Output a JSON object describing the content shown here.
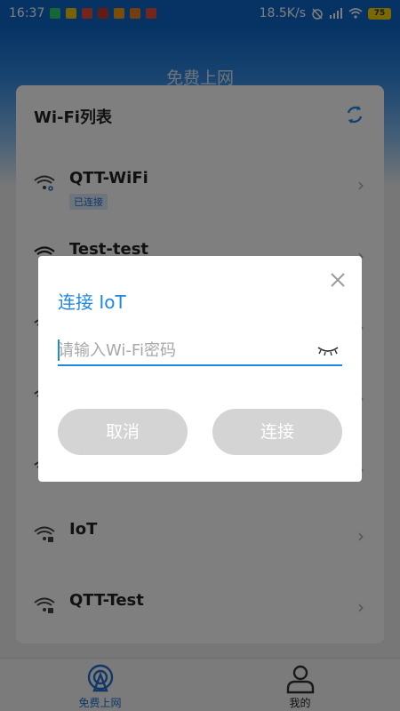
{
  "status_bar": {
    "time": "16:37",
    "net_speed": "18.5K/s",
    "battery": "75",
    "notification_colors": [
      "#2ecc71",
      "#f1c40f",
      "#e74c3c",
      "#c0392b",
      "#f39c12",
      "#e67e22",
      "#e74c3c"
    ]
  },
  "header": {
    "title": "免费上网"
  },
  "wifi_list": {
    "title": "Wi-Fi列表",
    "items": [
      {
        "ssid": "QTT-WiFi",
        "badge": "已连接"
      },
      {
        "ssid": "Test-test",
        "badge": ""
      },
      {
        "ssid": "",
        "badge": ""
      },
      {
        "ssid": "",
        "badge": ""
      },
      {
        "ssid": "",
        "badge": ""
      },
      {
        "ssid": "IoT",
        "badge": ""
      },
      {
        "ssid": "QTT-Test",
        "badge": ""
      }
    ]
  },
  "tabs": [
    {
      "label": "免费上网",
      "active": true
    },
    {
      "label": "我的",
      "active": false
    }
  ],
  "dialog": {
    "title": "连接 IoT",
    "password_placeholder": "请输入Wi-Fi密码",
    "cancel_label": "取消",
    "connect_label": "连接"
  },
  "colors": {
    "accent": "#1e88e5",
    "header_blue": "#0c67c8",
    "button_disabled": "#d4d4d4"
  }
}
